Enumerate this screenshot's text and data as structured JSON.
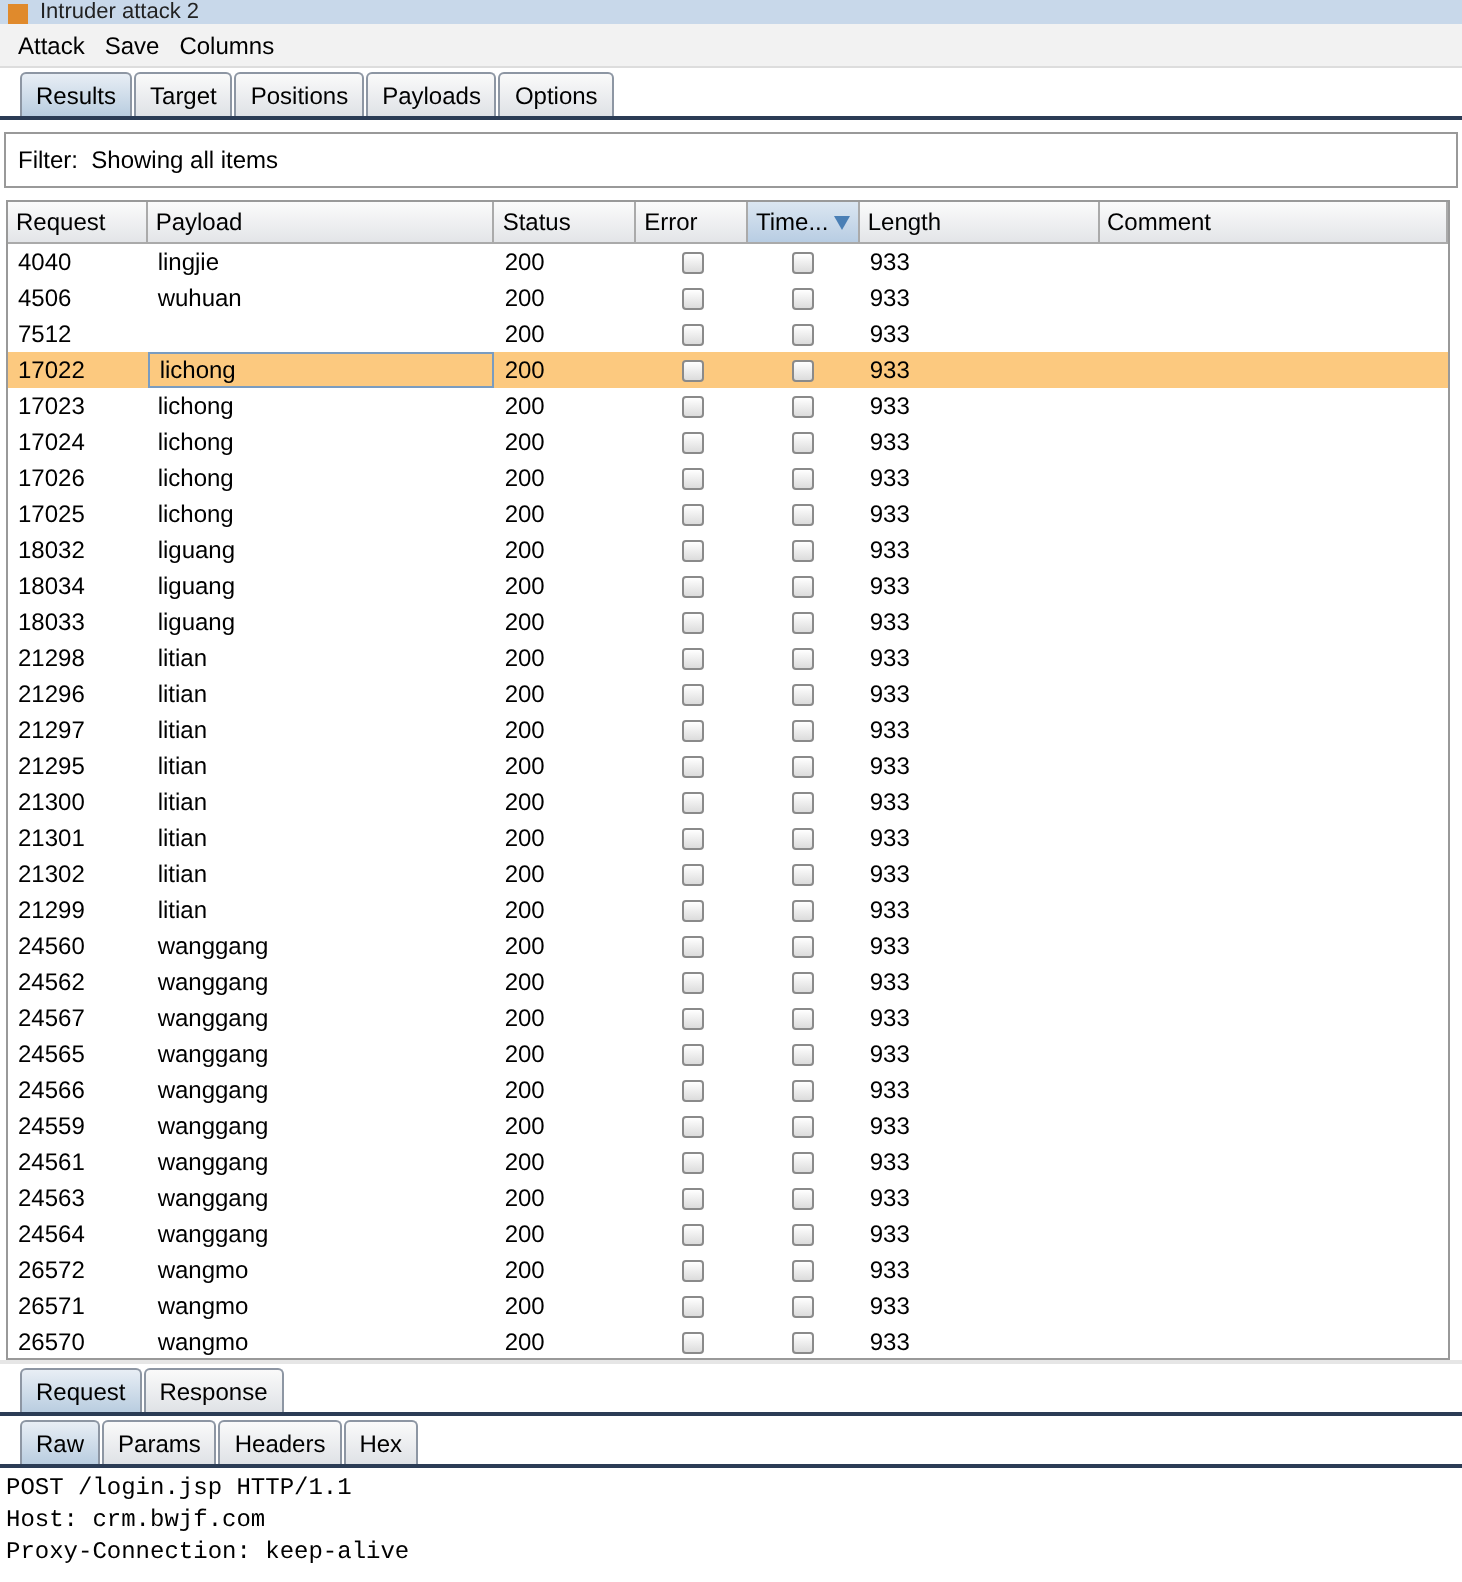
{
  "window": {
    "title": "Intruder attack 2"
  },
  "menu": [
    "Attack",
    "Save",
    "Columns"
  ],
  "tabs": [
    {
      "label": "Results",
      "selected": true
    },
    {
      "label": "Target",
      "selected": false
    },
    {
      "label": "Positions",
      "selected": false
    },
    {
      "label": "Payloads",
      "selected": false
    },
    {
      "label": "Options",
      "selected": false
    }
  ],
  "filter": "Filter:  Showing all items",
  "table": {
    "columns": [
      {
        "label": "Request",
        "sorted": false
      },
      {
        "label": "Payload",
        "sorted": false
      },
      {
        "label": "Status",
        "sorted": false
      },
      {
        "label": "Error",
        "sorted": false
      },
      {
        "label": "Time...",
        "sorted": true
      },
      {
        "label": "Length",
        "sorted": false
      },
      {
        "label": "Comment",
        "sorted": false
      }
    ],
    "rows": [
      {
        "request": "4040",
        "payload": "lingjie",
        "status": "200",
        "error": false,
        "timeout": false,
        "length": "933",
        "selected": false
      },
      {
        "request": "4506",
        "payload": "wuhuan",
        "status": "200",
        "error": false,
        "timeout": false,
        "length": "933",
        "selected": false
      },
      {
        "request": "7512",
        "status": "200",
        "error": false,
        "timeout": false,
        "length": "933",
        "selected": false
      },
      {
        "request": "17022",
        "payload": "lichong",
        "status": "200",
        "error": false,
        "timeout": false,
        "length": "933",
        "selected": true
      },
      {
        "request": "17023",
        "payload": "lichong",
        "status": "200",
        "error": false,
        "timeout": false,
        "length": "933",
        "selected": false
      },
      {
        "request": "17024",
        "payload": "lichong",
        "status": "200",
        "error": false,
        "timeout": false,
        "length": "933",
        "selected": false
      },
      {
        "request": "17026",
        "payload": "lichong",
        "status": "200",
        "error": false,
        "timeout": false,
        "length": "933",
        "selected": false
      },
      {
        "request": "17025",
        "payload": "lichong",
        "status": "200",
        "error": false,
        "timeout": false,
        "length": "933",
        "selected": false
      },
      {
        "request": "18032",
        "payload": "liguang",
        "status": "200",
        "error": false,
        "timeout": false,
        "length": "933",
        "selected": false
      },
      {
        "request": "18034",
        "payload": "liguang",
        "status": "200",
        "error": false,
        "timeout": false,
        "length": "933",
        "selected": false
      },
      {
        "request": "18033",
        "payload": "liguang",
        "status": "200",
        "error": false,
        "timeout": false,
        "length": "933",
        "selected": false
      },
      {
        "request": "21298",
        "payload": "litian",
        "status": "200",
        "error": false,
        "timeout": false,
        "length": "933",
        "selected": false
      },
      {
        "request": "21296",
        "payload": "litian",
        "status": "200",
        "error": false,
        "timeout": false,
        "length": "933",
        "selected": false
      },
      {
        "request": "21297",
        "payload": "litian",
        "status": "200",
        "error": false,
        "timeout": false,
        "length": "933",
        "selected": false
      },
      {
        "request": "21295",
        "payload": "litian",
        "status": "200",
        "error": false,
        "timeout": false,
        "length": "933",
        "selected": false
      },
      {
        "request": "21300",
        "payload": "litian",
        "status": "200",
        "error": false,
        "timeout": false,
        "length": "933",
        "selected": false
      },
      {
        "request": "21301",
        "payload": "litian",
        "status": "200",
        "error": false,
        "timeout": false,
        "length": "933",
        "selected": false
      },
      {
        "request": "21302",
        "payload": "litian",
        "status": "200",
        "error": false,
        "timeout": false,
        "length": "933",
        "selected": false
      },
      {
        "request": "21299",
        "payload": "litian",
        "status": "200",
        "error": false,
        "timeout": false,
        "length": "933",
        "selected": false
      },
      {
        "request": "24560",
        "payload": "wanggang",
        "status": "200",
        "error": false,
        "timeout": false,
        "length": "933",
        "selected": false
      },
      {
        "request": "24562",
        "payload": "wanggang",
        "status": "200",
        "error": false,
        "timeout": false,
        "length": "933",
        "selected": false
      },
      {
        "request": "24567",
        "payload": "wanggang",
        "status": "200",
        "error": false,
        "timeout": false,
        "length": "933",
        "selected": false
      },
      {
        "request": "24565",
        "payload": "wanggang",
        "status": "200",
        "error": false,
        "timeout": false,
        "length": "933",
        "selected": false
      },
      {
        "request": "24566",
        "payload": "wanggang",
        "status": "200",
        "error": false,
        "timeout": false,
        "length": "933",
        "selected": false
      },
      {
        "request": "24559",
        "payload": "wanggang",
        "status": "200",
        "error": false,
        "timeout": false,
        "length": "933",
        "selected": false
      },
      {
        "request": "24561",
        "payload": "wanggang",
        "status": "200",
        "error": false,
        "timeout": false,
        "length": "933",
        "selected": false
      },
      {
        "request": "24563",
        "payload": "wanggang",
        "status": "200",
        "error": false,
        "timeout": false,
        "length": "933",
        "selected": false
      },
      {
        "request": "24564",
        "payload": "wanggang",
        "status": "200",
        "error": false,
        "timeout": false,
        "length": "933",
        "selected": false
      },
      {
        "request": "26572",
        "payload": "wangmo",
        "status": "200",
        "error": false,
        "timeout": false,
        "length": "933",
        "selected": false
      },
      {
        "request": "26571",
        "payload": "wangmo",
        "status": "200",
        "error": false,
        "timeout": false,
        "length": "933",
        "selected": false
      },
      {
        "request": "26570",
        "payload": "wangmo",
        "status": "200",
        "error": false,
        "timeout": false,
        "length": "933",
        "selected": false
      }
    ]
  },
  "message_tabs": [
    {
      "label": "Request",
      "selected": true
    },
    {
      "label": "Response",
      "selected": false
    }
  ],
  "view_tabs": [
    {
      "label": "Raw",
      "selected": true
    },
    {
      "label": "Params",
      "selected": false
    },
    {
      "label": "Headers",
      "selected": false
    },
    {
      "label": "Hex",
      "selected": false
    }
  ],
  "raw_lines": [
    "POST /login.jsp HTTP/1.1",
    "Host: crm.bwjf.com",
    "Proxy-Connection: keep-alive"
  ]
}
